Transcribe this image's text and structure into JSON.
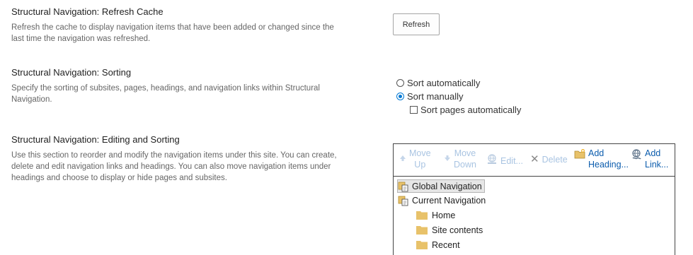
{
  "refresh_cache": {
    "title": "Structural Navigation: Refresh Cache",
    "description": "Refresh the cache to display navigation items that have been added or changed since the last time the navigation was refreshed.",
    "button_label": "Refresh"
  },
  "sorting": {
    "title": "Structural Navigation: Sorting",
    "description": "Specify the sorting of subsites, pages, headings, and navigation links within Structural Navigation.",
    "options": [
      {
        "label": "Sort automatically",
        "checked": false
      },
      {
        "label": "Sort manually",
        "checked": true
      }
    ],
    "sort_pages_label": "Sort pages automatically",
    "sort_pages_checked": false
  },
  "editing": {
    "title": "Structural Navigation: Editing and Sorting",
    "description": "Use this section to reorder and modify the navigation items under this site. You can create, delete and edit navigation links and headings. You can also move navigation items under headings and choose to display or hide pages and subsites.",
    "toolbar": {
      "move_up": {
        "line1": "Move",
        "line2": "Up",
        "icon": "arrow-up-icon"
      },
      "move_down": {
        "line1": "Move",
        "line2": "Down",
        "icon": "arrow-down-icon"
      },
      "edit": {
        "label": "Edit...",
        "icon": "link-edit-icon"
      },
      "delete": {
        "label": "Delete",
        "icon": "x-icon"
      },
      "add_heading": {
        "line1": "Add",
        "line2": "Heading...",
        "icon": "folder-add-icon"
      },
      "add_link": {
        "line1": "Add",
        "line2": "Link...",
        "icon": "link-add-icon"
      }
    },
    "tree": {
      "global": "Global Navigation",
      "current": "Current Navigation",
      "children": [
        "Home",
        "Site contents",
        "Recent"
      ]
    }
  },
  "colors": {
    "link_blue": "#0b5cad",
    "disabled_blue": "#a9c4e2",
    "radio_blue": "#0078d4",
    "folder_yellow": "#e8c26a"
  }
}
